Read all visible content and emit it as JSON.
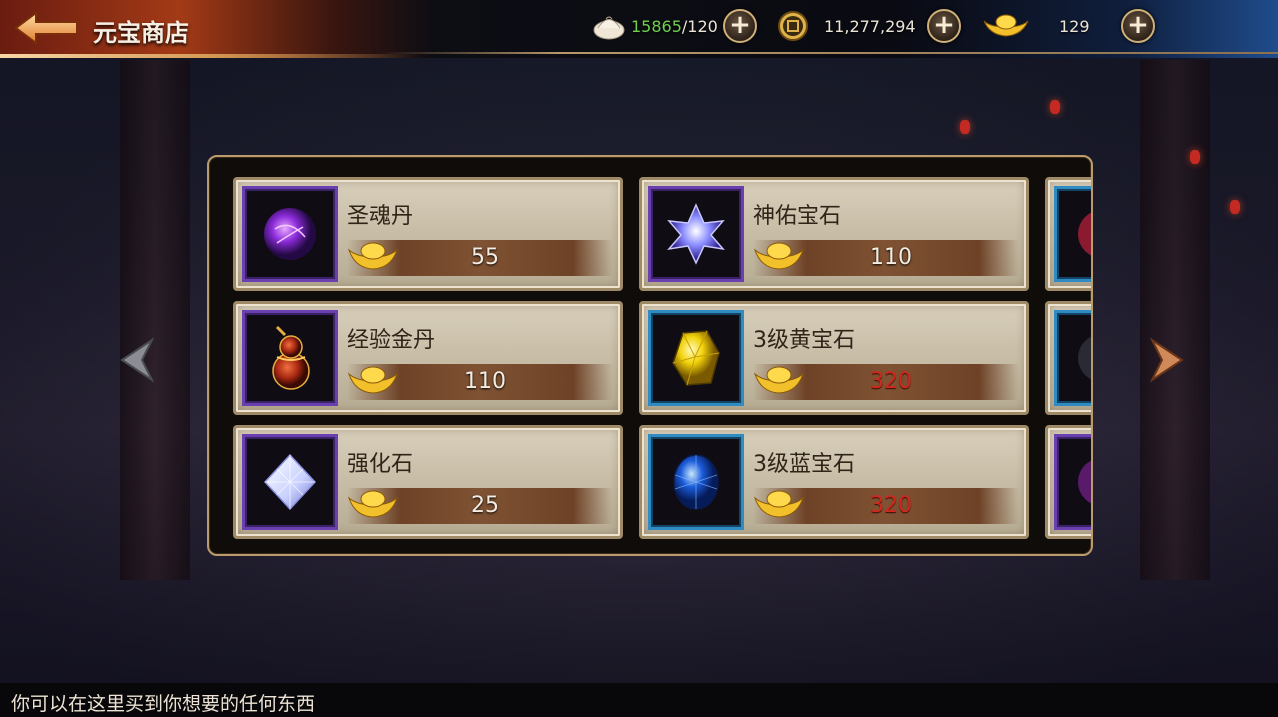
{
  "header": {
    "title": "元宝商店",
    "stamina": {
      "current": "15865",
      "max": "/120"
    },
    "coins": "11,277,294",
    "yuanbao": "129"
  },
  "colors": {
    "stamina_green": "#6ed24b",
    "price_red": "#d0281e",
    "price_white": "#f2ece2",
    "purple_frame": "#6a3fb0",
    "blue_frame": "#2f8bc2"
  },
  "items": [
    {
      "name": "圣魂丹",
      "price": "55",
      "icon": "purple-orb-icon"
    },
    {
      "name": "神佑宝石",
      "price": "110",
      "icon": "star-gem-icon"
    },
    {
      "name": "经验金丹",
      "price": "110",
      "icon": "gourd-icon"
    },
    {
      "name": "3级黄宝石",
      "price": "320",
      "icon": "yellow-gem-icon"
    },
    {
      "name": "强化石",
      "price": "25",
      "icon": "white-diamond-icon"
    },
    {
      "name": "3级蓝宝石",
      "price": "320",
      "icon": "blue-gem-icon"
    }
  ],
  "footer": {
    "tip": "你可以在这里买到你想要的任何东西"
  }
}
